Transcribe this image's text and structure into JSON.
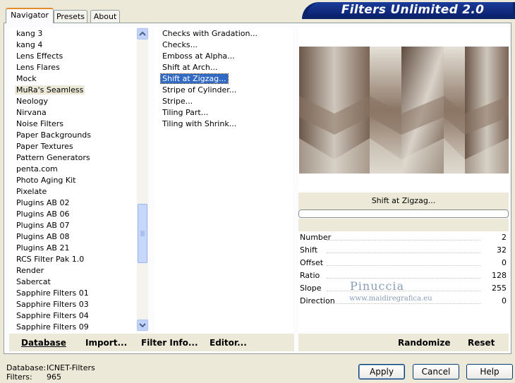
{
  "app": {
    "title": "Filters Unlimited 2.0"
  },
  "tabs": [
    {
      "label": "Navigator",
      "active": true
    },
    {
      "label": "Presets",
      "active": false
    },
    {
      "label": "About",
      "active": false
    }
  ],
  "categories": {
    "items": [
      "kang 3",
      "kang 4",
      "Lens Effects",
      "Lens Flares",
      "Mock",
      "MuRa's Seamless",
      "Neology",
      "Nirvana",
      "Noise Filters",
      "Paper Backgrounds",
      "Paper Textures",
      "Pattern Generators",
      "penta.com",
      "Photo Aging Kit",
      "Pixelate",
      "Plugins AB 02",
      "Plugins AB 06",
      "Plugins AB 07",
      "Plugins AB 08",
      "Plugins AB 21",
      "RCS Filter Pak 1.0",
      "Render",
      "Sabercat",
      "Sapphire Filters 01",
      "Sapphire Filters 03",
      "Sapphire Filters 04",
      "Sapphire Filters 09"
    ],
    "selected": "MuRa's Seamless"
  },
  "filters": {
    "items": [
      "Checks with Gradation...",
      "Checks...",
      "Emboss at Alpha...",
      "Shift at Arch...",
      "Shift at Zigzag...",
      "Stripe of Cylinder...",
      "Stripe...",
      "Tiling Part...",
      "Tiling with Shrink..."
    ],
    "selected": "Shift at Zigzag..."
  },
  "preview": {
    "filter_name": "Shift at Zigzag...",
    "watermark_line1": "Pinuccia",
    "watermark_line2": "www.maidiregrafica.eu"
  },
  "params": [
    {
      "label": "Number",
      "value": "2"
    },
    {
      "label": "Shift",
      "value": "32"
    },
    {
      "label": "Offset",
      "value": "0"
    },
    {
      "label": "Ratio",
      "value": "128"
    },
    {
      "label": "Slope",
      "value": "255"
    },
    {
      "label": "Direction",
      "value": "0"
    }
  ],
  "buttons": {
    "database": "Database",
    "import": "Import...",
    "filter_info": "Filter Info...",
    "editor": "Editor...",
    "randomize": "Randomize",
    "reset": "Reset",
    "apply": "Apply",
    "cancel": "Cancel",
    "help": "Help"
  },
  "status": {
    "database_label": "Database:",
    "database_value": "ICNET-Filters",
    "filters_label": "Filters:",
    "filters_value": "965"
  },
  "colors": {
    "banner": "#0A246A",
    "selection": "#316AC5",
    "tab_highlight": "#E68B2C"
  }
}
